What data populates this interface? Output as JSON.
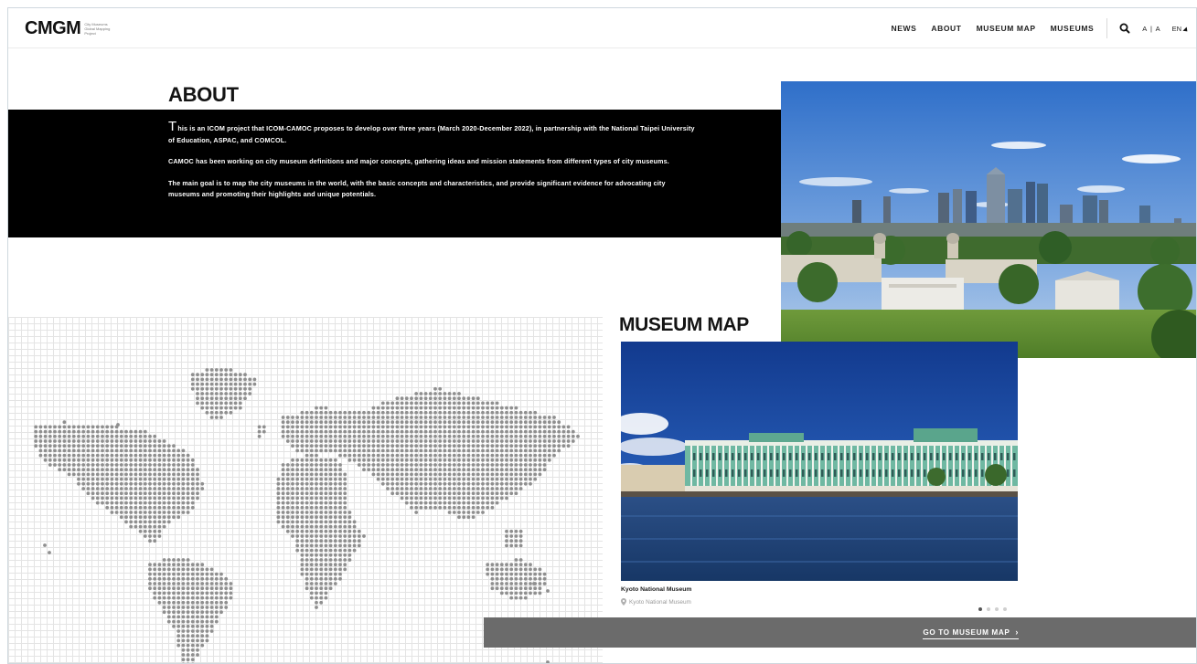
{
  "header": {
    "logo": "CMGM",
    "logo_sub": "City Museums Global Mapping Project",
    "nav": [
      "NEWS",
      "ABOUT",
      "MUSEUM MAP",
      "MUSEUMS"
    ],
    "size_toggle": "A | A",
    "language": "EN"
  },
  "about": {
    "title": "ABOUT",
    "dropcap": "T",
    "p1_rest": "his is an ICOM project that ICOM-CAMOC proposes to develop over three years (March 2020-December 2022), in partnership with the National Taipei University of Education, ASPAC, and COMCOL.",
    "p2": "CAMOC has been working on city museum definitions and major concepts, gathering ideas and mission statements from different types of city museums.",
    "p3": "The main goal is to map the city museums in the world, with the basic concepts and characteristics, and provide significant evidence for advocating city museums and promoting their highlights and unique potentials."
  },
  "museum_map": {
    "title": "MUSEUM MAP",
    "caption_title": "Kyoto National Museum",
    "caption_location": "Kyoto National Museum",
    "slide_count": 4,
    "active_slide": 1,
    "cta": "GO TO MUSEUM MAP"
  },
  "icons": {
    "search": "search-icon",
    "pin": "map-pin-icon",
    "chevron": "chevron-right-icon"
  }
}
